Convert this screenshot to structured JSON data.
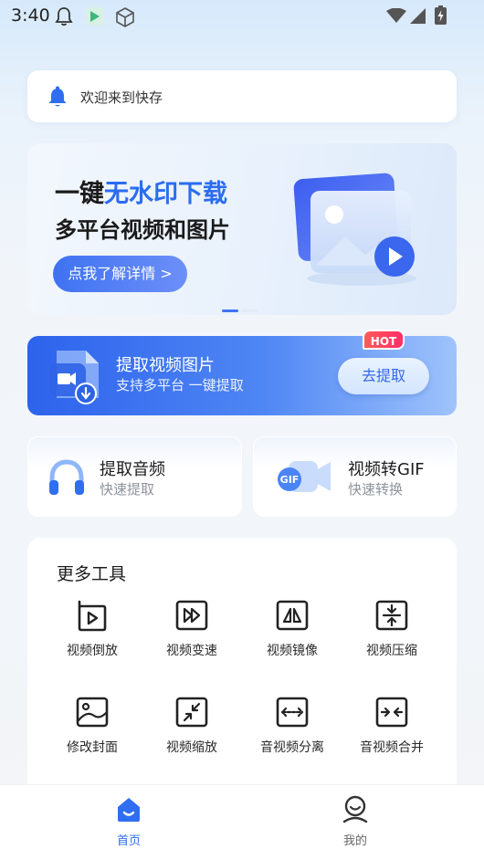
{
  "status_bar": {
    "time": "3:40",
    "icons": [
      "bell-icon",
      "app-notification-icon",
      "package-icon",
      "wifi-icon",
      "signal-icon",
      "battery-charging-icon"
    ]
  },
  "notice": {
    "icon": "bell-icon",
    "text": "欢迎来到快存"
  },
  "banner": {
    "line1_prefix": "一键",
    "line1_highlight": "无水印下载",
    "line2": "多平台视频和图片",
    "button_label": "点我了解详情 >",
    "accent_color": "#2b6cf0",
    "indicator": {
      "active": 1,
      "count": 2
    }
  },
  "extract": {
    "title": "提取视频图片",
    "subtitle": "支持多平台 一键提取",
    "button_label": "去提取",
    "badge": "HOT"
  },
  "tools": [
    {
      "icon": "headphones-icon",
      "title": "提取音频",
      "subtitle": "快速提取"
    },
    {
      "icon": "gif-video-icon",
      "title": "视频转GIF",
      "subtitle": "快速转换"
    }
  ],
  "more_tools": {
    "heading": "更多工具",
    "items": [
      {
        "icon": "video-reverse-icon",
        "label": "视频倒放"
      },
      {
        "icon": "video-speed-icon",
        "label": "视频变速"
      },
      {
        "icon": "video-mirror-icon",
        "label": "视频镜像"
      },
      {
        "icon": "video-compress-icon",
        "label": "视频压缩"
      },
      {
        "icon": "edit-cover-icon",
        "label": "修改封面"
      },
      {
        "icon": "video-scale-icon",
        "label": "视频缩放"
      },
      {
        "icon": "av-split-icon",
        "label": "音视频分离"
      },
      {
        "icon": "av-merge-icon",
        "label": "音视频合并"
      }
    ]
  },
  "tabbar": {
    "tabs": [
      {
        "icon": "home-icon",
        "label": "首页",
        "active": true
      },
      {
        "icon": "profile-icon",
        "label": "我的",
        "active": false
      }
    ]
  }
}
